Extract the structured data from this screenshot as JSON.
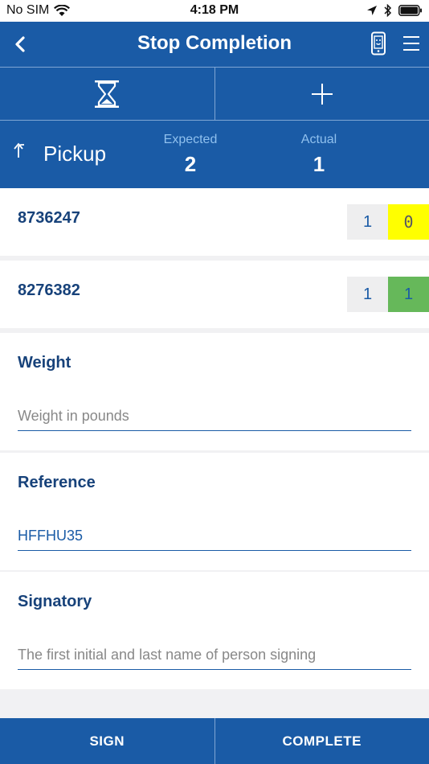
{
  "status_bar": {
    "carrier": "No SIM",
    "time": "4:18 PM"
  },
  "nav": {
    "title": "Stop Completion"
  },
  "summary": {
    "stop_type": "Pickup",
    "expected_label": "Expected",
    "expected_value": "2",
    "actual_label": "Actual",
    "actual_value": "1"
  },
  "items": [
    {
      "id": "8736247",
      "expected": "1",
      "actual": "0",
      "actual_color": "#ffff00"
    },
    {
      "id": "8276382",
      "expected": "1",
      "actual": "1",
      "actual_color": "#66b85a"
    }
  ],
  "fields": {
    "weight": {
      "label": "Weight",
      "value": "",
      "placeholder": "Weight in pounds"
    },
    "reference": {
      "label": "Reference",
      "value": "HFFHU35",
      "placeholder": ""
    },
    "signatory": {
      "label": "Signatory",
      "value": "",
      "placeholder": "The first initial and last name of person signing"
    }
  },
  "actions": {
    "sign_label": "SIGN",
    "complete_label": "COMPLETE"
  },
  "colors": {
    "primary": "#1a5ba6",
    "label_text": "#17427a"
  }
}
